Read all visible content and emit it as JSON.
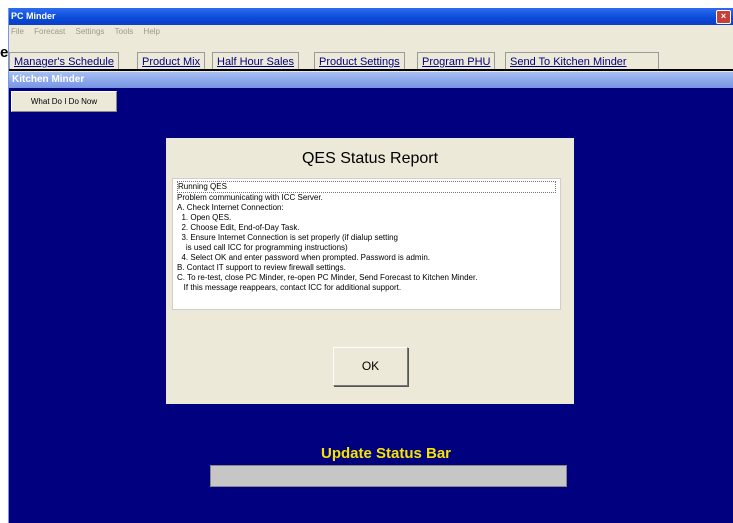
{
  "window": {
    "title": "PC Minder",
    "close_glyph": "×"
  },
  "menu": [
    "File",
    "Forecast",
    "Settings",
    "Tools",
    "Help"
  ],
  "tabs": [
    {
      "label": "Manager's Schedule"
    },
    {
      "label": "Product Mix"
    },
    {
      "label": "Half Hour Sales"
    },
    {
      "label": "Product Settings"
    },
    {
      "label": "Program PHU"
    },
    {
      "label": "Send To Kitchen Minder",
      "active": true
    }
  ],
  "left_edge_glyph": "e",
  "subheader": {
    "title": "Kitchen Minder"
  },
  "help_button": {
    "label": "What Do I Do Now"
  },
  "dialog": {
    "title": "QES Status Report",
    "lines": [
      "Running QES",
      "Problem communicating with ICC Server.",
      "A. Check Internet Connection:",
      "  1. Open QES.",
      "  2. Choose Edit, End-of-Day Task.",
      "  3. Ensure Internet Connection is set properly (if dialup setting",
      "    is used call ICC for programming instructions)",
      "  4. Select OK and enter password when prompted. Password is admin.",
      "B. Contact IT support to review firewall settings.",
      "C. To re-test, close PC Minder, re-open PC Minder, Send Forecast to Kitchen Minder.",
      "   If this message reappears, contact ICC for additional support."
    ],
    "ok_label": "OK"
  },
  "status": {
    "title": "Update Status Bar",
    "progress": 0
  },
  "colors": {
    "background": "#01007f",
    "status_title": "#f5e400"
  }
}
